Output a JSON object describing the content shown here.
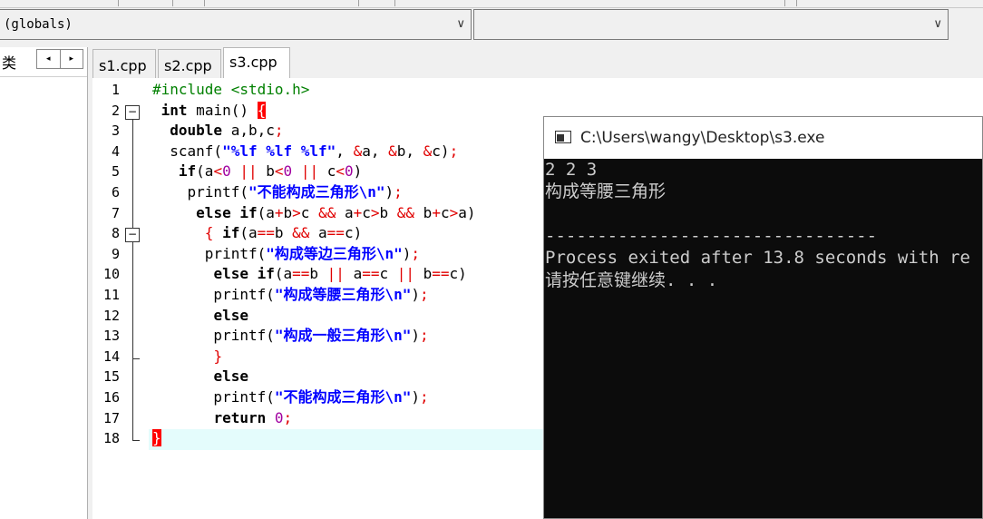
{
  "toolbar": {
    "scope_value": "(globals)",
    "member_value": ""
  },
  "class_panel": {
    "label": "类",
    "prev": "◂",
    "next": "▸"
  },
  "tabs": [
    {
      "label": "s1.cpp",
      "active": false
    },
    {
      "label": "s2.cpp",
      "active": false
    },
    {
      "label": "s3.cpp",
      "active": true
    }
  ],
  "editor": {
    "line_numbers": [
      "1",
      "2",
      "3",
      "4",
      "5",
      "6",
      "7",
      "8",
      "9",
      "10",
      "11",
      "12",
      "13",
      "14",
      "15",
      "16",
      "17",
      "18"
    ],
    "fold_marker": "−",
    "highlighted_line": 18,
    "lines": [
      [
        {
          "t": "#include <stdio.h>",
          "c": "pp"
        }
      ],
      [
        {
          "t": " "
        },
        {
          "t": "int",
          "c": "kw"
        },
        {
          "t": " main() "
        },
        {
          "t": "{",
          "c": "bm"
        }
      ],
      [
        {
          "t": "  "
        },
        {
          "t": "double",
          "c": "kw"
        },
        {
          "t": " a,b,c"
        },
        {
          "t": ";",
          "c": "sym"
        }
      ],
      [
        {
          "t": "  scanf("
        },
        {
          "t": "\"%lf %lf %lf\"",
          "c": "str"
        },
        {
          "t": ", "
        },
        {
          "t": "&",
          "c": "sym"
        },
        {
          "t": "a, "
        },
        {
          "t": "&",
          "c": "sym"
        },
        {
          "t": "b, "
        },
        {
          "t": "&",
          "c": "sym"
        },
        {
          "t": "c)"
        },
        {
          "t": ";",
          "c": "sym"
        }
      ],
      [
        {
          "t": "   "
        },
        {
          "t": "if",
          "c": "kw"
        },
        {
          "t": "(a"
        },
        {
          "t": "<",
          "c": "sym"
        },
        {
          "t": "0",
          "c": "num"
        },
        {
          "t": " "
        },
        {
          "t": "||",
          "c": "sym"
        },
        {
          "t": " b"
        },
        {
          "t": "<",
          "c": "sym"
        },
        {
          "t": "0",
          "c": "num"
        },
        {
          "t": " "
        },
        {
          "t": "||",
          "c": "sym"
        },
        {
          "t": " c"
        },
        {
          "t": "<",
          "c": "sym"
        },
        {
          "t": "0",
          "c": "num"
        },
        {
          "t": ")"
        }
      ],
      [
        {
          "t": "    printf("
        },
        {
          "t": "\"不能构成三角形\\n\"",
          "c": "str"
        },
        {
          "t": ")"
        },
        {
          "t": ";",
          "c": "sym"
        }
      ],
      [
        {
          "t": "     "
        },
        {
          "t": "else",
          "c": "kw"
        },
        {
          "t": " "
        },
        {
          "t": "if",
          "c": "kw"
        },
        {
          "t": "(a"
        },
        {
          "t": "+",
          "c": "sym"
        },
        {
          "t": "b"
        },
        {
          "t": ">",
          "c": "sym"
        },
        {
          "t": "c "
        },
        {
          "t": "&&",
          "c": "sym"
        },
        {
          "t": " a"
        },
        {
          "t": "+",
          "c": "sym"
        },
        {
          "t": "c"
        },
        {
          "t": ">",
          "c": "sym"
        },
        {
          "t": "b "
        },
        {
          "t": "&&",
          "c": "sym"
        },
        {
          "t": " b"
        },
        {
          "t": "+",
          "c": "sym"
        },
        {
          "t": "c"
        },
        {
          "t": ">",
          "c": "sym"
        },
        {
          "t": "a)"
        }
      ],
      [
        {
          "t": "      "
        },
        {
          "t": "{",
          "c": "sym"
        },
        {
          "t": " "
        },
        {
          "t": "if",
          "c": "kw"
        },
        {
          "t": "(a"
        },
        {
          "t": "==",
          "c": "sym"
        },
        {
          "t": "b "
        },
        {
          "t": "&&",
          "c": "sym"
        },
        {
          "t": " a"
        },
        {
          "t": "==",
          "c": "sym"
        },
        {
          "t": "c)"
        }
      ],
      [
        {
          "t": "      printf("
        },
        {
          "t": "\"构成等边三角形\\n\"",
          "c": "str"
        },
        {
          "t": ")"
        },
        {
          "t": ";",
          "c": "sym"
        }
      ],
      [
        {
          "t": "       "
        },
        {
          "t": "else",
          "c": "kw"
        },
        {
          "t": " "
        },
        {
          "t": "if",
          "c": "kw"
        },
        {
          "t": "(a"
        },
        {
          "t": "==",
          "c": "sym"
        },
        {
          "t": "b "
        },
        {
          "t": "||",
          "c": "sym"
        },
        {
          "t": " a"
        },
        {
          "t": "==",
          "c": "sym"
        },
        {
          "t": "c "
        },
        {
          "t": "||",
          "c": "sym"
        },
        {
          "t": " b"
        },
        {
          "t": "==",
          "c": "sym"
        },
        {
          "t": "c)"
        }
      ],
      [
        {
          "t": "       printf("
        },
        {
          "t": "\"构成等腰三角形\\n\"",
          "c": "str"
        },
        {
          "t": ")"
        },
        {
          "t": ";",
          "c": "sym"
        }
      ],
      [
        {
          "t": "       "
        },
        {
          "t": "else",
          "c": "kw"
        }
      ],
      [
        {
          "t": "       printf("
        },
        {
          "t": "\"构成一般三角形\\n\"",
          "c": "str"
        },
        {
          "t": ")"
        },
        {
          "t": ";",
          "c": "sym"
        }
      ],
      [
        {
          "t": "       "
        },
        {
          "t": "}",
          "c": "sym"
        }
      ],
      [
        {
          "t": "       "
        },
        {
          "t": "else",
          "c": "kw"
        }
      ],
      [
        {
          "t": "       printf("
        },
        {
          "t": "\"不能构成三角形\\n\"",
          "c": "str"
        },
        {
          "t": ")"
        },
        {
          "t": ";",
          "c": "sym"
        }
      ],
      [
        {
          "t": "       "
        },
        {
          "t": "return",
          "c": "kw"
        },
        {
          "t": " "
        },
        {
          "t": "0",
          "c": "num"
        },
        {
          "t": ";",
          "c": "sym"
        }
      ],
      [
        {
          "t": "}",
          "c": "bm"
        }
      ]
    ]
  },
  "console": {
    "title": "C:\\Users\\wangy\\Desktop\\s3.exe",
    "lines": [
      "2 2 3",
      "构成等腰三角形",
      "",
      "--------------------------------",
      "Process exited after 13.8 seconds with re",
      "请按任意键继续. . ."
    ]
  },
  "colors": {
    "keyword": "#000000",
    "preprocessor": "#008000",
    "symbol": "#e00000",
    "string": "#0000ff",
    "number": "#a000a0",
    "current_line": "#e4fcfc",
    "brace_match": "#ff0000",
    "console_bg": "#0c0c0c",
    "console_fg": "#cccccc"
  }
}
